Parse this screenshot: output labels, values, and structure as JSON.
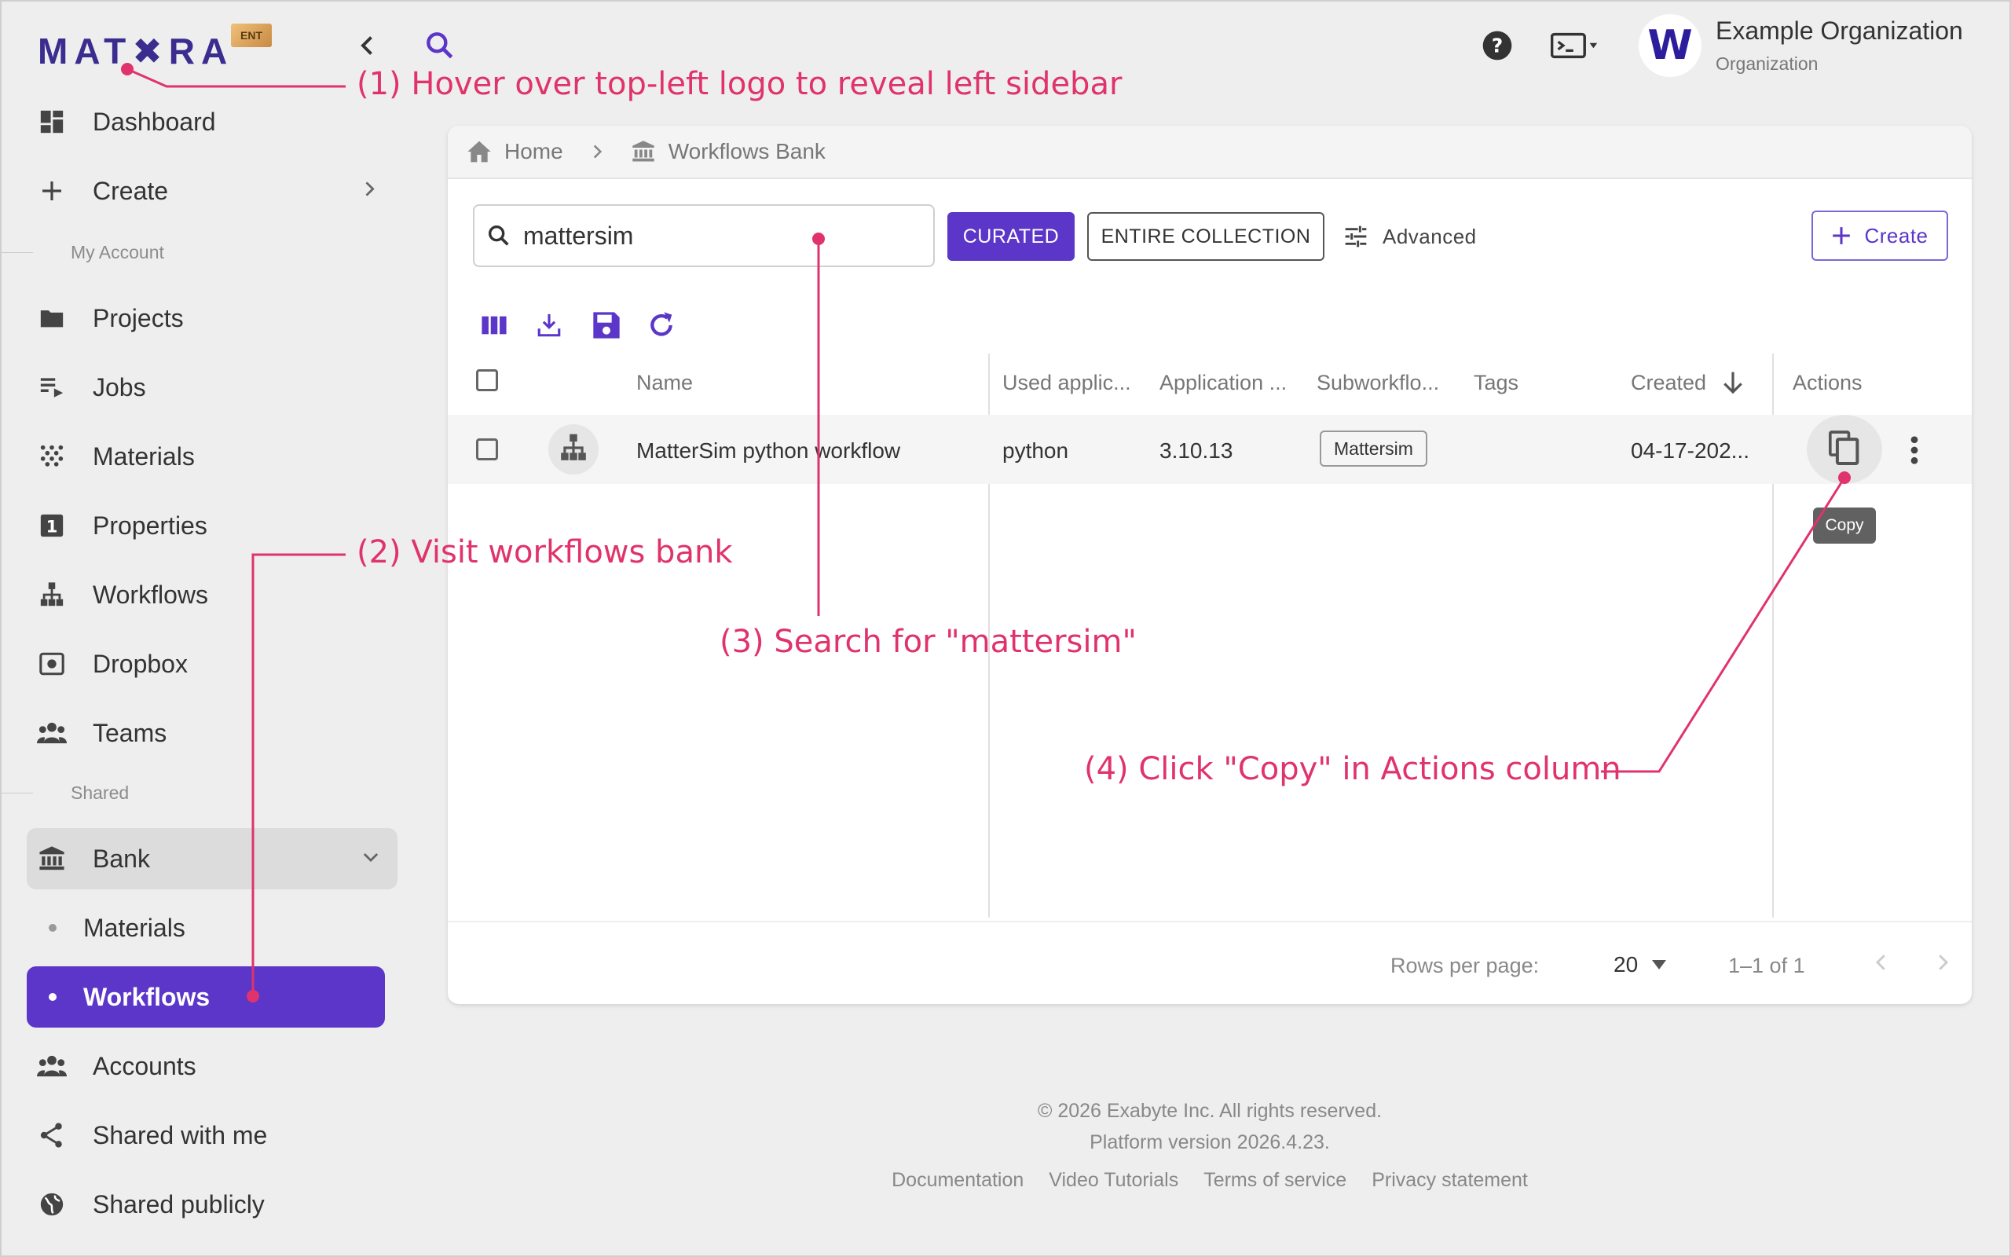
{
  "brand": {
    "logo_text": "MAT✖RA",
    "badge": "ENT"
  },
  "org": {
    "avatar_letter": "W",
    "name": "Example Organization",
    "type": "Organization"
  },
  "sidebar": {
    "top_items": [
      {
        "label": "Dashboard"
      },
      {
        "label": "Create"
      }
    ],
    "my_account_label": "My Account",
    "account_items": [
      {
        "label": "Projects"
      },
      {
        "label": "Jobs"
      },
      {
        "label": "Materials"
      },
      {
        "label": "Properties"
      },
      {
        "label": "Workflows"
      },
      {
        "label": "Dropbox"
      },
      {
        "label": "Teams"
      }
    ],
    "shared_label": "Shared",
    "bank_label": "Bank",
    "bank_sub": [
      {
        "label": "Materials"
      },
      {
        "label": "Workflows"
      }
    ],
    "shared_items": [
      {
        "label": "Accounts"
      },
      {
        "label": "Shared with me"
      },
      {
        "label": "Shared publicly"
      }
    ]
  },
  "breadcrumb": {
    "home": "Home",
    "current": "Workflows Bank"
  },
  "search": {
    "value": "mattersim",
    "placeholder": ""
  },
  "filters": {
    "curated": "CURATED",
    "entire": "ENTIRE COLLECTION",
    "advanced": "Advanced",
    "create": "Create"
  },
  "table": {
    "columns": [
      "Name",
      "Used applic...",
      "Application ...",
      "Subworkflo...",
      "Tags",
      "Created",
      "Actions"
    ],
    "rows": [
      {
        "name": "MatterSim python workflow",
        "app": "python",
        "version": "3.10.13",
        "subworkflow": "Mattersim",
        "tags": "",
        "created": "04-17-202..."
      }
    ],
    "tooltip": "Copy"
  },
  "pagination": {
    "rows_per_page_label": "Rows per page:",
    "rows_per_page": "20",
    "range": "1–1 of 1"
  },
  "footer": {
    "copyright": "© 2026 Exabyte Inc. All rights reserved.",
    "version": "Platform version 2026.4.23.",
    "links": [
      "Documentation",
      "Video Tutorials",
      "Terms of service",
      "Privacy statement"
    ]
  },
  "annotations": {
    "step1": "(1) Hover over top-left logo to reveal left sidebar",
    "step2": "(2) Visit workflows bank",
    "step3": "(3) Search for \"mattersim\"",
    "step4": "(4) Click \"Copy\" in Actions column"
  },
  "colors": {
    "accent": "#5b36c8",
    "annotation": "#e0336b",
    "logo": "#3a2d8f"
  }
}
